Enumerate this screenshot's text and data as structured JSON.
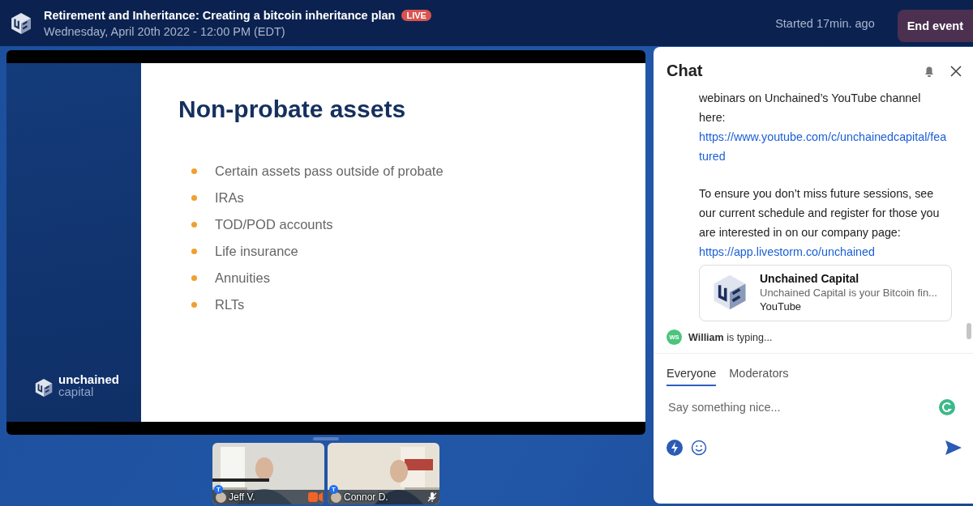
{
  "header": {
    "title": "Retirement and Inheritance: Creating a bitcoin inheritance plan",
    "badge": "LIVE",
    "date": "Wednesday, April 20th 2022 - 12:00 PM (EDT)",
    "started": "Started 17min. ago",
    "end_button": "End event"
  },
  "slide": {
    "heading": "Non-probate assets",
    "bullets": [
      "Certain assets pass outside of probate",
      "IRAs",
      "TOD/POD accounts",
      "Life insurance",
      "Annuities",
      "RLTs"
    ],
    "logo_top": "unchained",
    "logo_bottom": "capital"
  },
  "participants": [
    {
      "name": "Jeff V.",
      "badge": "T",
      "muted": false
    },
    {
      "name": "Connor D.",
      "badge": "T",
      "muted": true
    }
  ],
  "chat": {
    "title": "Chat",
    "messages": [
      {
        "kind": "text",
        "text": "webinars on Unchained’s YouTube channel here:"
      },
      {
        "kind": "link",
        "text": "https://www.youtube.com/c/unchainedcapital/featured"
      },
      {
        "kind": "text",
        "text": "To ensure you don’t miss future sessions, see our current schedule and register for those you are interested in on our company page:"
      },
      {
        "kind": "link",
        "text": "https://app.livestorm.co/unchained"
      }
    ],
    "preview": {
      "title": "Unchained Capital",
      "description": "Unchained Capital is your Bitcoin fin...",
      "source": "YouTube"
    },
    "typing": {
      "initials": "WS",
      "text": "**William** is typing..."
    },
    "tabs": [
      {
        "label": "Everyone",
        "selected": true
      },
      {
        "label": "Moderators",
        "selected": false
      }
    ],
    "input": {
      "placeholder": "Say something nice..."
    }
  }
}
